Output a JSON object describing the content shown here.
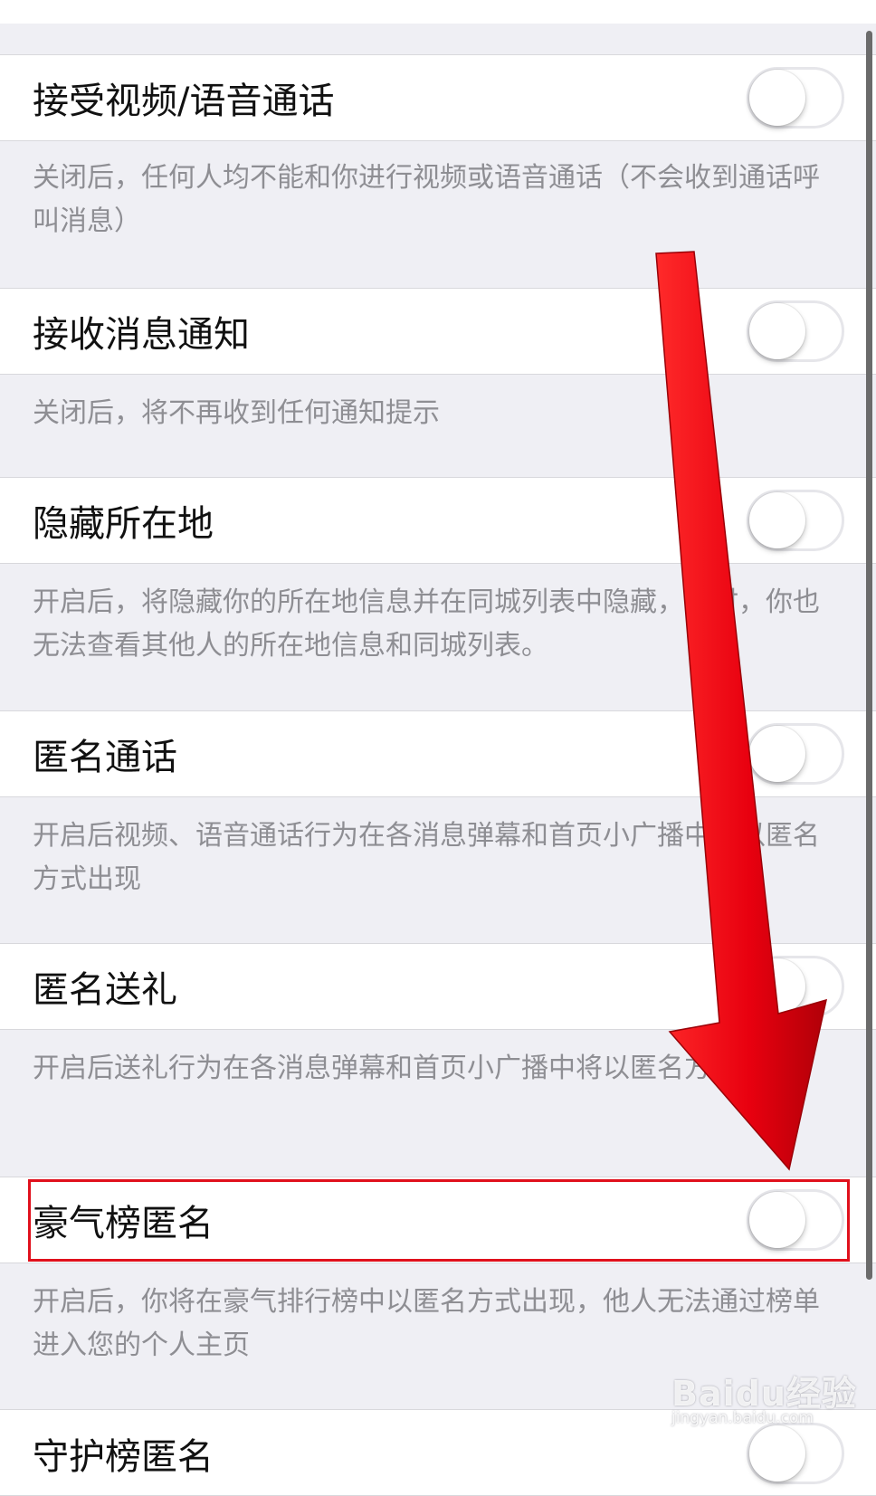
{
  "settings": {
    "items": [
      {
        "label": "接受视频/语音通话",
        "enabled": false,
        "description": "关闭后，任何人均不能和你进行视频或语音通话（不会收到通话呼叫消息）"
      },
      {
        "label": "接收消息通知",
        "enabled": false,
        "description": "关闭后，将不再收到任何通知提示"
      },
      {
        "label": "隐藏所在地",
        "enabled": false,
        "description": "开启后，将隐藏你的所在地信息并在同城列表中隐藏，同时，你也无法查看其他人的所在地信息和同城列表。"
      },
      {
        "label": "匿名通话",
        "enabled": false,
        "description": "开启后视频、语音通话行为在各消息弹幕和首页小广播中将以匿名方式出现"
      },
      {
        "label": "匿名送礼",
        "enabled": false,
        "description": "开启后送礼行为在各消息弹幕和首页小广播中将以匿名方式出现"
      },
      {
        "label": "豪气榜匿名",
        "enabled": false,
        "description": "开启后，你将在豪气排行榜中以匿名方式出现，他人无法通过榜单进入您的个人主页"
      },
      {
        "label": "守护榜匿名",
        "enabled": false
      }
    ]
  },
  "annotations": {
    "highlight_color": "#e0101c",
    "arrow_color": "#e8000f"
  },
  "watermark": {
    "logo_text": "Baidu经验",
    "url": "jingyan.baidu.com"
  },
  "colors": {
    "background": "#efeff4",
    "row_background": "#ffffff",
    "description_text": "#8e8e93"
  }
}
